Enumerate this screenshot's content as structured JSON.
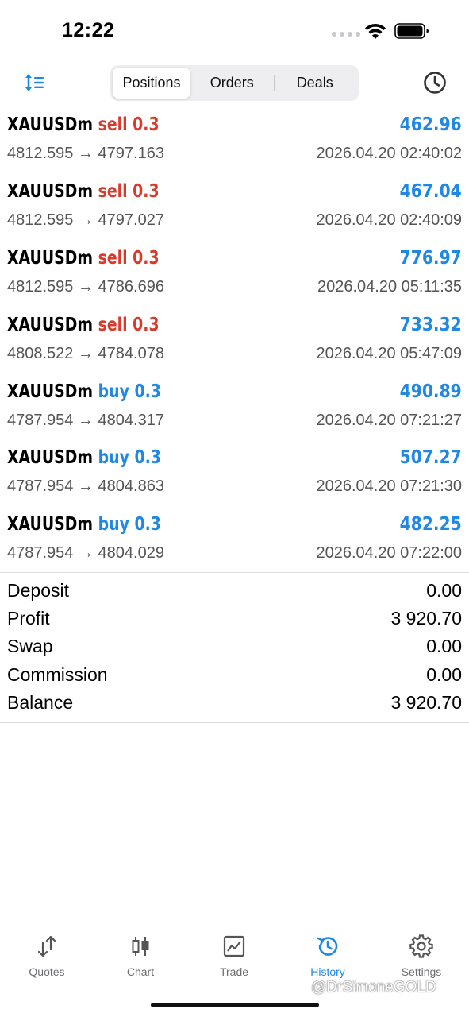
{
  "status_bar": {
    "time": "12:22"
  },
  "tabs": [
    {
      "label": "Positions",
      "active": true
    },
    {
      "label": "Orders",
      "active": false
    },
    {
      "label": "Deals",
      "active": false
    }
  ],
  "deals": [
    {
      "symbol": "XAUUSDm",
      "direction": "sell",
      "volume": "sell 0.3",
      "profit": "462.96",
      "prices": "4812.595 → 4797.163",
      "time": "2026.04.20 02:40:02"
    },
    {
      "symbol": "XAUUSDm",
      "direction": "sell",
      "volume": "sell 0.3",
      "profit": "467.04",
      "prices": "4812.595 → 4797.027",
      "time": "2026.04.20 02:40:09"
    },
    {
      "symbol": "XAUUSDm",
      "direction": "sell",
      "volume": "sell 0.3",
      "profit": "776.97",
      "prices": "4812.595 → 4786.696",
      "time": "2026.04.20 05:11:35"
    },
    {
      "symbol": "XAUUSDm",
      "direction": "sell",
      "volume": "sell 0.3",
      "profit": "733.32",
      "prices": "4808.522 → 4784.078",
      "time": "2026.04.20 05:47:09"
    },
    {
      "symbol": "XAUUSDm",
      "direction": "buy",
      "volume": "buy 0.3",
      "profit": "490.89",
      "prices": "4787.954 → 4804.317",
      "time": "2026.04.20 07:21:27"
    },
    {
      "symbol": "XAUUSDm",
      "direction": "buy",
      "volume": "buy 0.3",
      "profit": "507.27",
      "prices": "4787.954 → 4804.863",
      "time": "2026.04.20 07:21:30"
    },
    {
      "symbol": "XAUUSDm",
      "direction": "buy",
      "volume": "buy 0.3",
      "profit": "482.25",
      "prices": "4787.954 → 4804.029",
      "time": "2026.04.20 07:22:00"
    }
  ],
  "summary": [
    {
      "label": "Deposit",
      "value": "0.00"
    },
    {
      "label": "Profit",
      "value": "3 920.70"
    },
    {
      "label": "Swap",
      "value": "0.00"
    },
    {
      "label": "Commission",
      "value": "0.00"
    },
    {
      "label": "Balance",
      "value": "3 920.70"
    }
  ],
  "tabbar": [
    {
      "label": "Quotes",
      "icon": "quotes-icon",
      "active": false
    },
    {
      "label": "Chart",
      "icon": "chart-icon",
      "active": false
    },
    {
      "label": "Trade",
      "icon": "trade-icon",
      "active": false
    },
    {
      "label": "History",
      "icon": "history-icon",
      "active": true
    },
    {
      "label": "Settings",
      "icon": "settings-icon",
      "active": false
    }
  ],
  "watermark": "@DrSimoneGOLD",
  "colors": {
    "sell": "#d93a2b",
    "buy": "#1f88e5",
    "profit": "#1f88e5",
    "active_tab": "#1f88e5"
  }
}
